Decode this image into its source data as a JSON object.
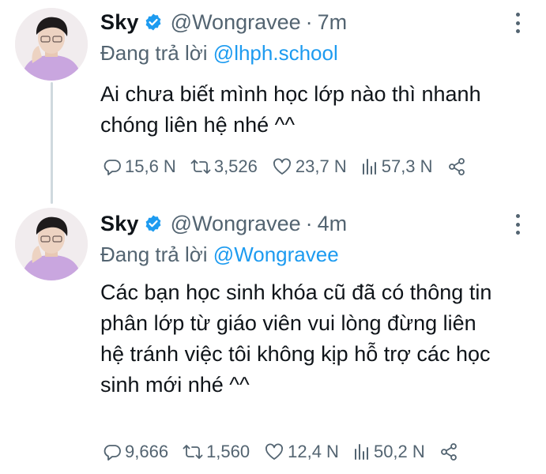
{
  "tweets": [
    {
      "name": "Sky",
      "handle": "@Wongravee",
      "separator": "·",
      "time": "7m",
      "reply_prefix": "Đang trả lời",
      "reply_to": "@lhph.school",
      "text": "Ai chưa biết mình học lớp nào thì nhanh chóng liên hệ nhé ^^",
      "replies": "15,6 N",
      "retweets": "3,526",
      "likes": "23,7 N",
      "views": "57,3 N"
    },
    {
      "name": "Sky",
      "handle": "@Wongravee",
      "separator": "·",
      "time": "4m",
      "reply_prefix": "Đang trả lời",
      "reply_to": "@Wongravee",
      "text": "Các bạn học sinh khóa cũ đã có thông tin phân lớp từ giáo viên vui lòng đừng liên hệ tránh việc tôi không kịp hỗ trợ các học sinh mới nhé ^^",
      "replies": "9,666",
      "retweets": "1,560",
      "likes": "12,4 N",
      "views": "50,2 N"
    }
  ],
  "colors": {
    "accent": "#1d9bf0",
    "secondary_text": "#536471",
    "text": "#0f1419",
    "avatar_shirt": "#c9a6df"
  },
  "icons": [
    "verified-badge-icon",
    "more-options-icon",
    "reply-icon",
    "retweet-icon",
    "like-icon",
    "views-icon",
    "share-icon"
  ]
}
